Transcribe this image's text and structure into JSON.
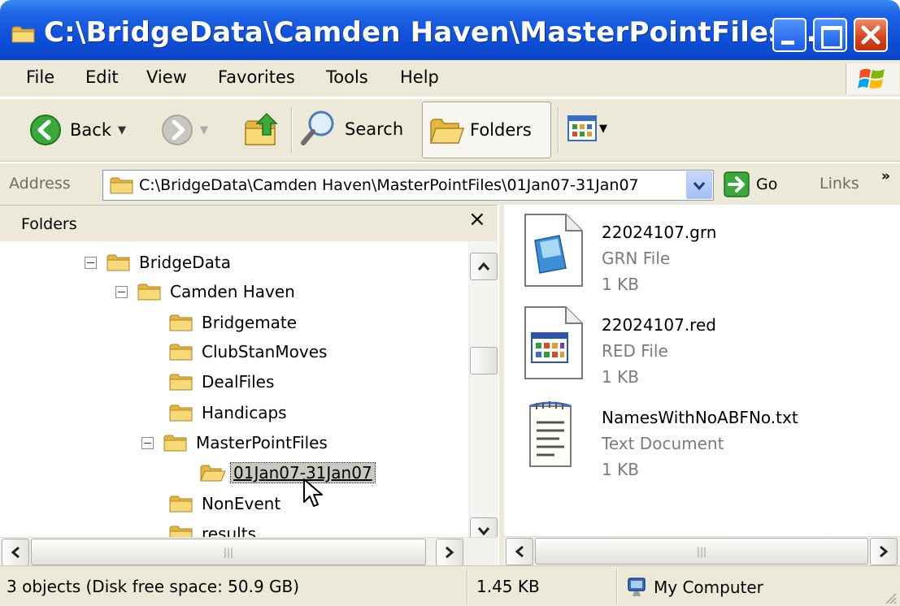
{
  "window": {
    "title": "C:\\BridgeData\\Camden Haven\\MasterPointFiles\\..."
  },
  "menu": {
    "items": [
      {
        "label": "File"
      },
      {
        "label": "Edit"
      },
      {
        "label": "View"
      },
      {
        "label": "Favorites"
      },
      {
        "label": "Tools"
      },
      {
        "label": "Help"
      }
    ]
  },
  "toolbar": {
    "back_label": "Back",
    "search_label": "Search",
    "folders_label": "Folders"
  },
  "address": {
    "label": "Address",
    "value": "C:\\BridgeData\\Camden Haven\\MasterPointFiles\\01Jan07-31Jan07",
    "go_label": "Go",
    "links_label": "Links",
    "links_chevron": "»"
  },
  "folders_pane": {
    "title": "Folders",
    "close_glyph": "×",
    "tree": [
      {
        "label": "BridgeData",
        "expanded": true
      },
      {
        "label": "Camden Haven",
        "expanded": true
      },
      {
        "label": "Bridgemate"
      },
      {
        "label": "ClubStanMoves"
      },
      {
        "label": "DealFiles"
      },
      {
        "label": "Handicaps"
      },
      {
        "label": "MasterPointFiles",
        "expanded": true
      },
      {
        "label": "01Jan07-31Jan07",
        "selected": true
      },
      {
        "label": "NonEvent"
      },
      {
        "label": "results"
      }
    ]
  },
  "files": [
    {
      "name": "22024107.grn",
      "type": "GRN File",
      "size": "1 KB",
      "icon": "grn-file-icon"
    },
    {
      "name": "22024107.red",
      "type": "RED File",
      "size": "1 KB",
      "icon": "red-file-icon"
    },
    {
      "name": "NamesWithNoABFNo.txt",
      "type": "Text Document",
      "size": "1 KB",
      "icon": "text-document-icon"
    }
  ],
  "statusbar": {
    "objects": "3 objects (Disk free space: 50.9 GB)",
    "size": "1.45 KB",
    "location": "My Computer"
  },
  "colors": {
    "titlebar": "#0d4fd8",
    "chrome": "#ece9d8",
    "folder_yellow": "#f5d56b",
    "close_red": "#d8431a"
  }
}
